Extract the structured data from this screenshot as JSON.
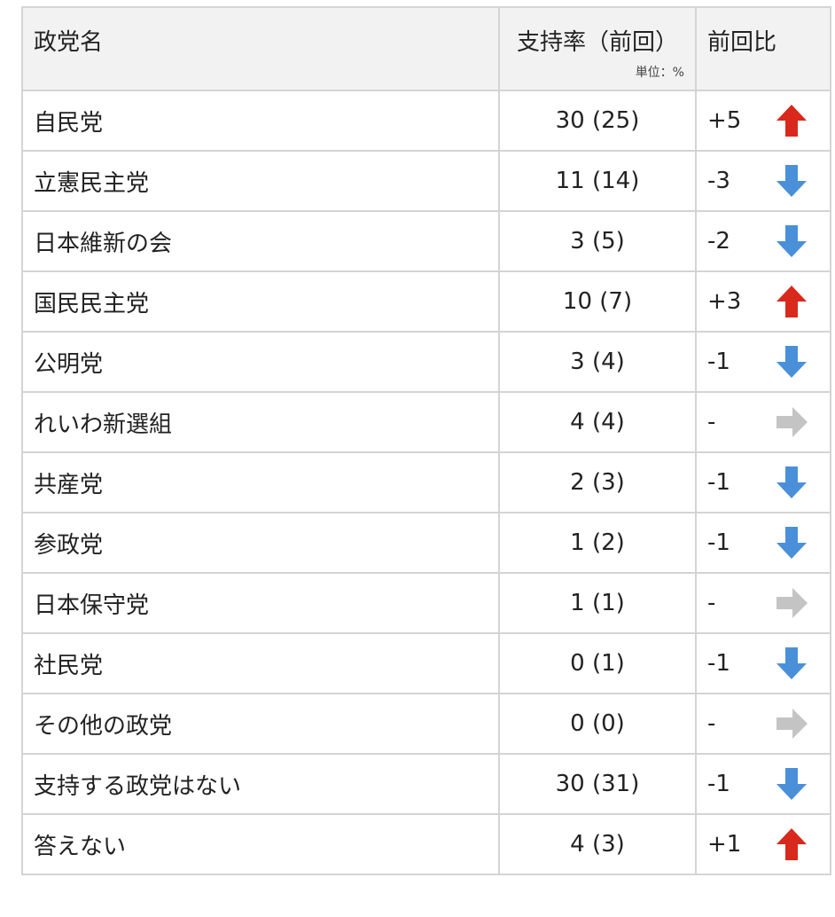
{
  "header": {
    "party": "政党名",
    "rate": "支持率（前回）",
    "unit": "単位：%",
    "diff": "前回比"
  },
  "colors": {
    "up": "#d9291c",
    "down": "#4a90d9",
    "same": "#c4c4c4"
  },
  "rows": [
    {
      "party": "自民党",
      "rate": "30 (25)",
      "diff": "+5",
      "trend": "up"
    },
    {
      "party": "立憲民主党",
      "rate": "11 (14)",
      "diff": "-3",
      "trend": "down"
    },
    {
      "party": "日本維新の会",
      "rate": "3 (5)",
      "diff": "-2",
      "trend": "down"
    },
    {
      "party": "国民民主党",
      "rate": "10 (7)",
      "diff": "+3",
      "trend": "up"
    },
    {
      "party": "公明党",
      "rate": "3 (4)",
      "diff": "-1",
      "trend": "down"
    },
    {
      "party": "れいわ新選組",
      "rate": "4 (4)",
      "diff": "-",
      "trend": "same"
    },
    {
      "party": "共産党",
      "rate": "2 (3)",
      "diff": "-1",
      "trend": "down"
    },
    {
      "party": "参政党",
      "rate": "1 (2)",
      "diff": "-1",
      "trend": "down"
    },
    {
      "party": "日本保守党",
      "rate": "1 (1)",
      "diff": "-",
      "trend": "same"
    },
    {
      "party": "社民党",
      "rate": "0 (1)",
      "diff": "-1",
      "trend": "down"
    },
    {
      "party": "その他の政党",
      "rate": "0 (0)",
      "diff": "-",
      "trend": "same"
    },
    {
      "party": "支持する政党はない",
      "rate": "30 (31)",
      "diff": "-1",
      "trend": "down"
    },
    {
      "party": "答えない",
      "rate": "4 (3)",
      "diff": "+1",
      "trend": "up"
    }
  ]
}
